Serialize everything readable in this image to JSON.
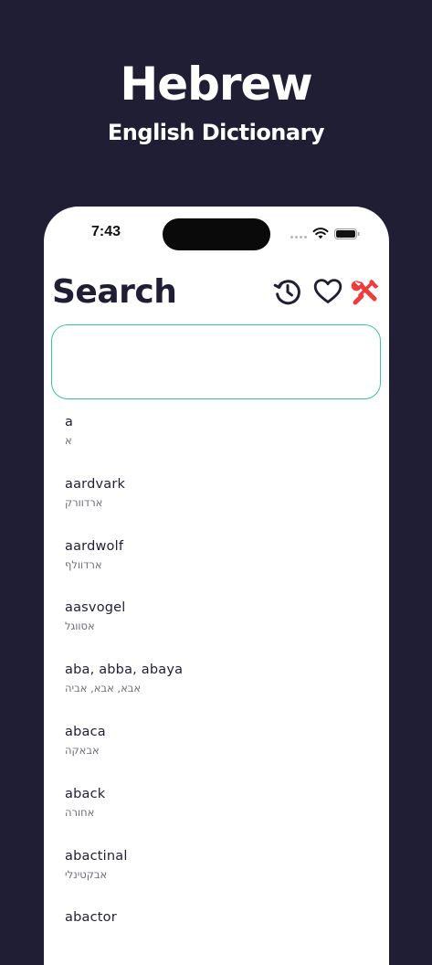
{
  "hero": {
    "title": "Hebrew",
    "subtitle": "English Dictionary"
  },
  "status_bar": {
    "time": "7:43"
  },
  "header": {
    "title": "Search"
  },
  "colors": {
    "background": "#1f1e35",
    "text_dark": "#1f1e35",
    "accent_green": "#3ec49a",
    "settings_red": "#ef3b3b"
  },
  "icons": [
    "history-icon",
    "heart-icon",
    "tools-icon",
    "wifi-icon",
    "battery-icon"
  ],
  "search": {
    "value": "",
    "placeholder": ""
  },
  "words": [
    {
      "english": "a",
      "hebrew": "א"
    },
    {
      "english": "aardvark",
      "hebrew": "ארדוורק"
    },
    {
      "english": "aardwolf",
      "hebrew": "ארדוולף"
    },
    {
      "english": "aasvogel",
      "hebrew": "אסווגל"
    },
    {
      "english": "aba, abba, abaya",
      "hebrew": "אבא, אבא, אביה"
    },
    {
      "english": "abaca",
      "hebrew": "אבאקה"
    },
    {
      "english": "aback",
      "hebrew": "אחורה"
    },
    {
      "english": "abactinal",
      "hebrew": "אבקטינלי"
    },
    {
      "english": "abactor",
      "hebrew": ""
    }
  ]
}
